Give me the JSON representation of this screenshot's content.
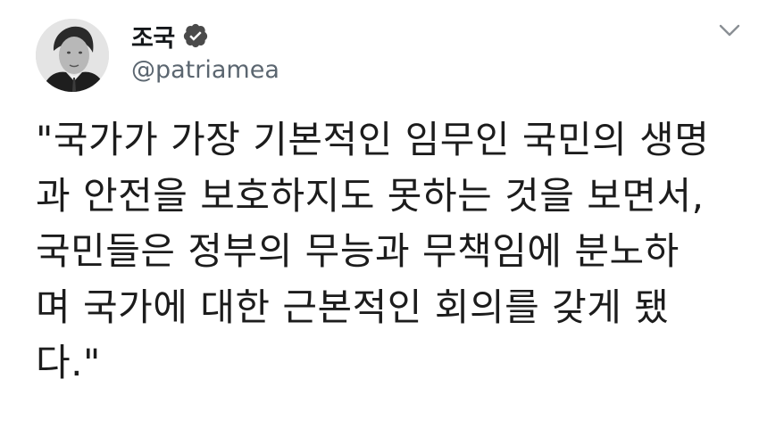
{
  "tweet": {
    "display_name": "조국",
    "handle": "@patriamea",
    "text_lines": [
      "\"국가가 가장 기본적인 임무인 국민의 생명",
      "과 안전을 보호하지도 못하는 것을 보면서,",
      "국민들은 정부의 무능과 무책임에 분노하",
      "며 국가에 대한 근본적인 회의를 갖게 됐",
      "다.\""
    ]
  },
  "icons": {
    "avatar": "profile-photo",
    "verified": "verified-badge-icon",
    "menu": "chevron-down-icon"
  },
  "colors": {
    "verified_badge": "#4a4a4a",
    "handle": "#5b6670",
    "chevron": "#8a8f94"
  }
}
